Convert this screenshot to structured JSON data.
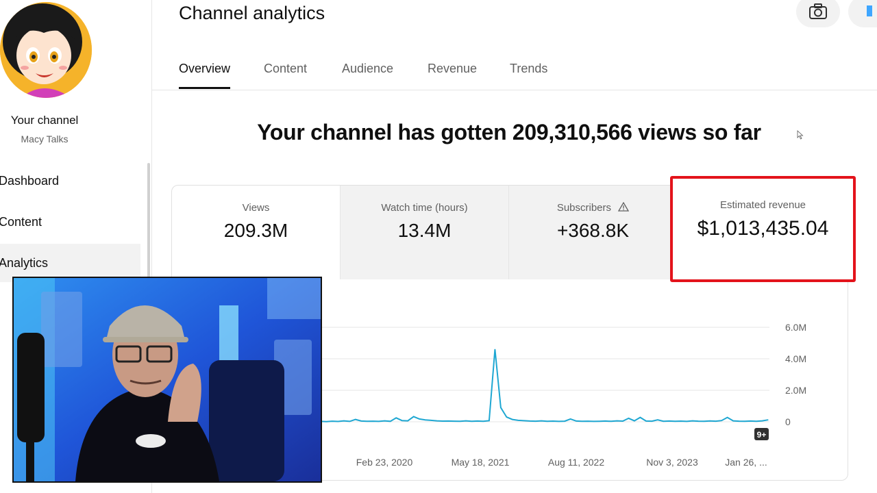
{
  "sidebar": {
    "channel_label": "Your channel",
    "channel_handle": "Macy Talks",
    "items": [
      {
        "label": "Dashboard"
      },
      {
        "label": "Content"
      },
      {
        "label": "Analytics"
      }
    ]
  },
  "header": {
    "title": "Channel analytics",
    "camera_icon": "camera-icon"
  },
  "tabs": [
    {
      "label": "Overview"
    },
    {
      "label": "Content"
    },
    {
      "label": "Audience"
    },
    {
      "label": "Revenue"
    },
    {
      "label": "Trends"
    }
  ],
  "headline": "Your channel has gotten 209,310,566 views so far",
  "metrics": [
    {
      "label": "Views",
      "value": "209.3M"
    },
    {
      "label": "Watch time (hours)",
      "value": "13.4M"
    },
    {
      "label": "Subscribers",
      "value": "+368.8K",
      "icon": "warning-icon"
    },
    {
      "label": "Estimated revenue",
      "value": "$1,013,435.04"
    }
  ],
  "colors": {
    "accent": "#1ea7d2",
    "highlight": "#e3131b",
    "tab_underline": "#0f0f0f"
  },
  "chart_data": {
    "type": "line",
    "x_tick_labels": [
      "Feb 23, 2020",
      "May 18, 2021",
      "Aug 11, 2022",
      "Nov 3, 2023",
      "Jan 26, ..."
    ],
    "y_tick_labels": [
      "0",
      "2.0M",
      "4.0M",
      "6.0M"
    ],
    "ylim": [
      0,
      6000000
    ],
    "grid": true,
    "badge": "9+",
    "series": [
      {
        "values": [
          30000,
          20000,
          25000,
          15000,
          40000,
          20000,
          60000,
          25000,
          150000,
          50000,
          30000,
          40000,
          25000,
          60000,
          30000,
          250000,
          80000,
          60000,
          330000,
          180000,
          120000,
          90000,
          60000,
          45000,
          50000,
          40000,
          30000,
          60000,
          35000,
          50000,
          30000,
          70000,
          4600000,
          900000,
          300000,
          150000,
          90000,
          70000,
          50000,
          40000,
          60000,
          30000,
          45000,
          25000,
          40000,
          180000,
          50000,
          30000,
          40000,
          25000,
          35000,
          50000,
          30000,
          60000,
          45000,
          220000,
          60000,
          280000,
          50000,
          40000,
          120000,
          35000,
          50000,
          30000,
          45000,
          25000,
          60000,
          40000,
          30000,
          55000,
          40000,
          80000,
          280000,
          60000,
          40000,
          30000,
          50000,
          35000,
          60000,
          120000
        ]
      }
    ]
  }
}
